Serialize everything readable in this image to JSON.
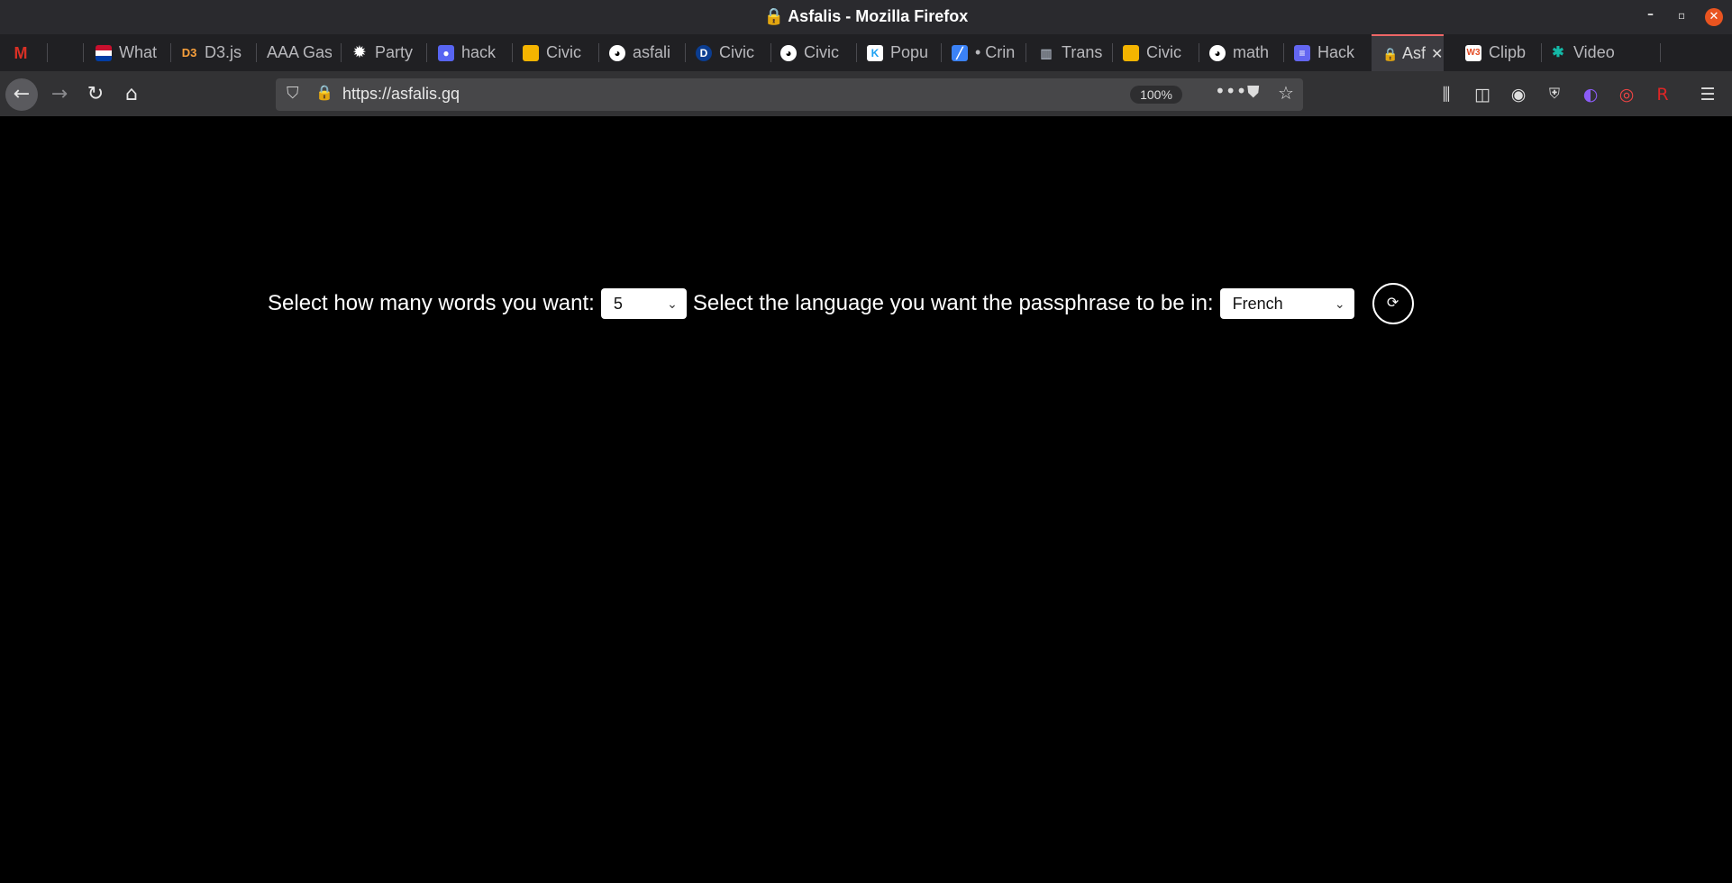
{
  "window": {
    "title": "Asfalis - Mozilla Firefox"
  },
  "tabs": [
    {
      "label": "",
      "icon": "gmail-icon",
      "color": "#d93025"
    },
    {
      "label": "What",
      "icon": "flag-icon",
      "color": "#c8102e"
    },
    {
      "label": "D3.js",
      "icon": "d3-icon",
      "color": "#f9a03c"
    },
    {
      "label": "AAA Gas",
      "icon": "",
      "color": ""
    },
    {
      "label": "Party",
      "icon": "gear-icon",
      "color": "#ffffff"
    },
    {
      "label": "hack",
      "icon": "hack-icon",
      "color": "#5865f2"
    },
    {
      "label": "Civic",
      "icon": "slides-icon",
      "color": "#f4b400"
    },
    {
      "label": "asfali",
      "icon": "github-icon",
      "color": "#ffffff"
    },
    {
      "label": "Civic",
      "icon": "d-icon",
      "color": "#0b3d91"
    },
    {
      "label": "Civic",
      "icon": "github-icon",
      "color": "#ffffff"
    },
    {
      "label": "Popu",
      "icon": "k-icon",
      "color": "#1da1f2"
    },
    {
      "label": "• Crin",
      "icon": "pen-icon",
      "color": "#3b82f6"
    },
    {
      "label": "Trans",
      "icon": "doc-icon",
      "color": "#9ca3af"
    },
    {
      "label": "Civic",
      "icon": "slides-icon",
      "color": "#f4b400"
    },
    {
      "label": "math",
      "icon": "github-icon",
      "color": "#ffffff"
    },
    {
      "label": "Hack",
      "icon": "list-icon",
      "color": "#6366f1"
    },
    {
      "label": "Asf",
      "icon": "lock-icon",
      "color": "#e8a33a",
      "active": true
    },
    {
      "label": "Clipb",
      "icon": "w3-icon",
      "color": "#e44d26"
    },
    {
      "label": "Video",
      "icon": "puzzle-icon",
      "color": "#14b8a6"
    }
  ],
  "navbar": {
    "url": "https://asfalis.gq",
    "zoom": "100%"
  },
  "form": {
    "words_label": "Select how many words you want:",
    "words_value": "5",
    "language_label": "Select the language you want the passphrase to be in:",
    "language_value": "French",
    "refresh_symbol": "⟳"
  }
}
